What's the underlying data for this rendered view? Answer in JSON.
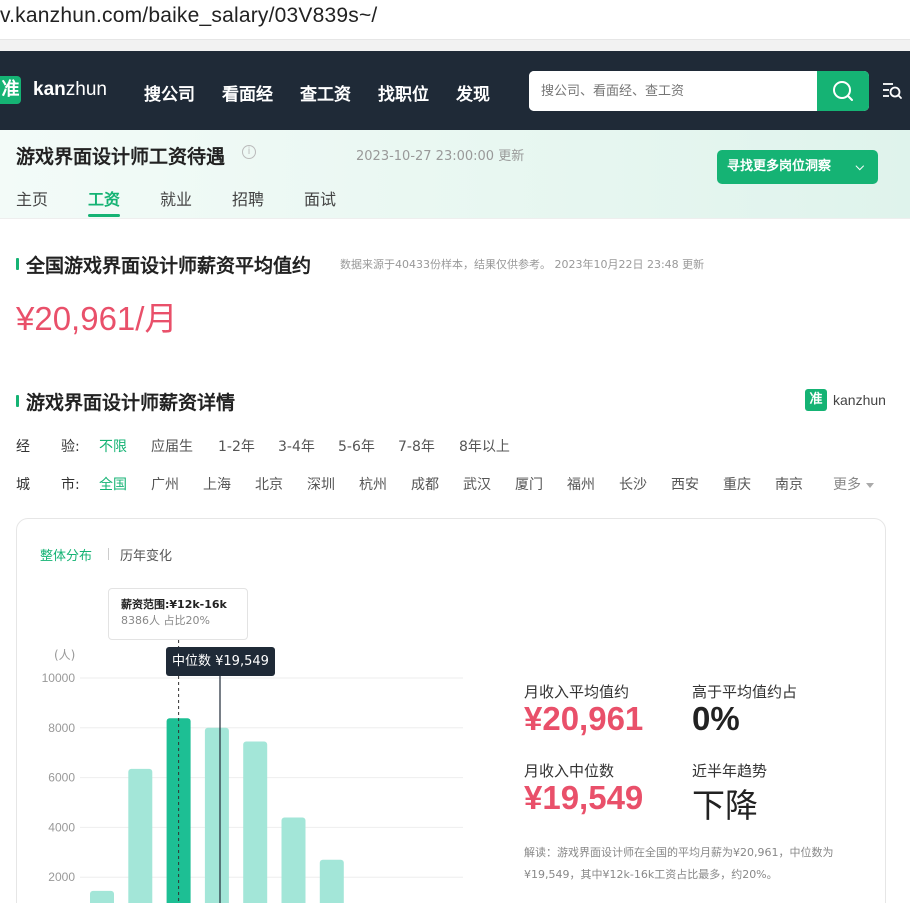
{
  "browser": {
    "url": "v.kanzhun.com/baike_salary/03V839s~/"
  },
  "nav": {
    "logo_mark": "准",
    "logo_bold": "kan",
    "logo_rest": "zhun",
    "items": [
      "搜公司",
      "看面经",
      "查工资",
      "找职位",
      "发现"
    ],
    "search_placeholder": "搜公司、看面经、查工资"
  },
  "header": {
    "title": "游戏界面设计师工资待遇",
    "info_mark": "i",
    "updated": "2023-10-27 23:00:00 更新",
    "cta_label": "寻找更多岗位洞察",
    "tabs": [
      "主页",
      "工资",
      "就业",
      "招聘",
      "面试"
    ],
    "active_tab": "工资"
  },
  "average_section": {
    "title": "全国游戏界面设计师薪资平均值约",
    "source_note": "数据来源于40433份样本，结果仅供参考。  2023年10月22日 23:48 更新",
    "value": "¥20,961/月"
  },
  "detail_section": {
    "title": "游戏界面设计师薪资详情",
    "brand_mark": "准",
    "brand_text": "kanzhun",
    "experience_label_1": "经",
    "experience_label_2": "验:",
    "experience_options": [
      "不限",
      "应届生",
      "1-2年",
      "3-4年",
      "5-6年",
      "7-8年",
      "8年以上"
    ],
    "city_label_1": "城",
    "city_label_2": "市:",
    "city_options": [
      "全国",
      "广州",
      "上海",
      "北京",
      "深圳",
      "杭州",
      "成都",
      "武汉",
      "厦门",
      "福州",
      "长沙",
      "西安",
      "重庆",
      "南京"
    ],
    "city_more": "更多"
  },
  "card": {
    "tabs": [
      "整体分布",
      "历年变化"
    ],
    "tooltip_title": "薪资范围:¥12k-16k",
    "tooltip_detail": "8386人  占比20%",
    "median_tag": "中位数 ¥19,549",
    "stats": {
      "avg_label": "月收入平均值约",
      "avg_value": "¥20,961",
      "above_label": "高于平均值约占",
      "above_value": "0%",
      "median_label": "月收入中位数",
      "median_value": "¥19,549",
      "trend_label": "近半年趋势",
      "trend_value": "下降"
    },
    "interpretation": "解读：游戏界面设计师在全国的平均月薪为¥20,961，中位数为¥19,549，其中¥12k-16k工资占比最多，约20%。"
  },
  "colors": {
    "accent": "#15b374",
    "price": "#e9506a",
    "nav_bg": "#1f2a37",
    "bar": "#a3e6d8",
    "bar_active": "#1dbf94"
  },
  "chart_data": {
    "type": "bar",
    "ylabel": "(人)",
    "yticks": [
      2000,
      4000,
      6000,
      8000,
      10000
    ],
    "ylim": [
      0,
      10000
    ],
    "values": [
      1450,
      6350,
      8386,
      8000,
      7450,
      4400,
      2700
    ],
    "highlighted_index": 2,
    "grid": true
  }
}
